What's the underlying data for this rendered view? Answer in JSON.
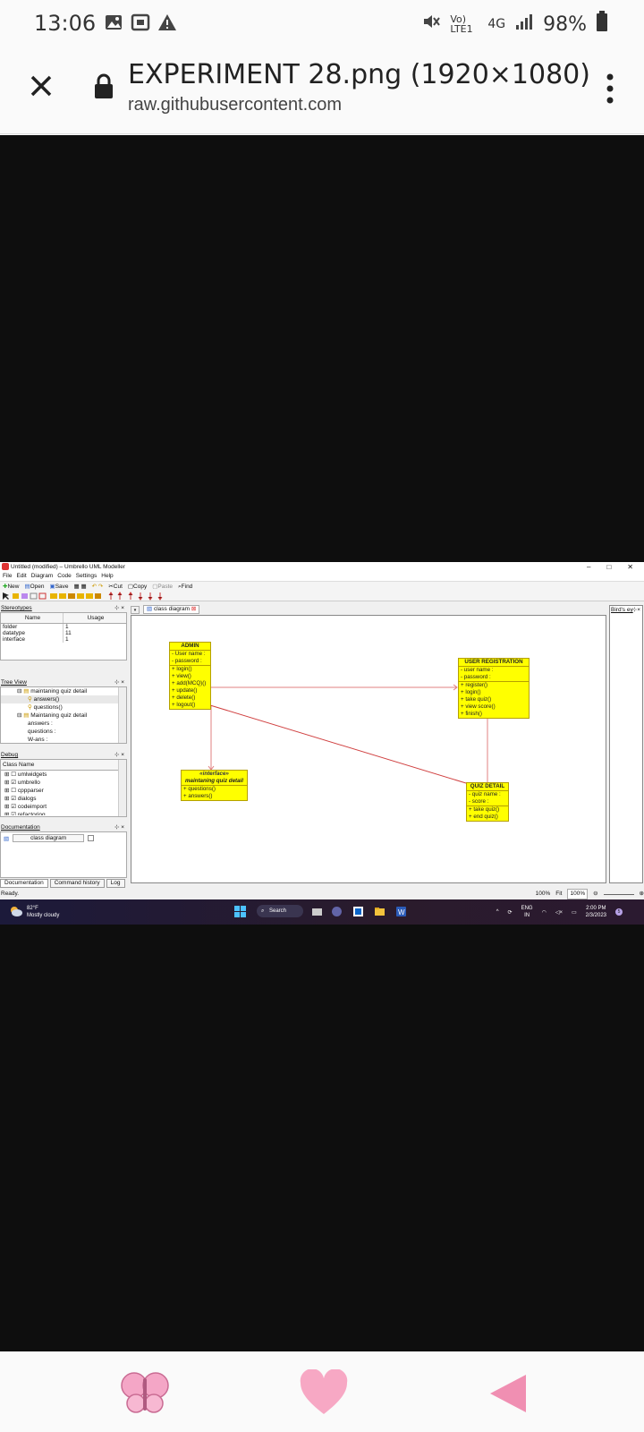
{
  "status_bar": {
    "time": "13:06",
    "lte_label": "Vo) LTE1",
    "net": "4G",
    "battery": "98%",
    "icons": [
      "image-icon",
      "screenshot-icon",
      "warning-icon",
      "mute-icon",
      "signal-icon",
      "battery-icon"
    ]
  },
  "browser": {
    "title": "EXPERIMENT 28.png (1920×1080)",
    "domain": "raw.githubusercontent.com"
  },
  "app": {
    "window_title": "Untitled (modified) – Umbrello UML Modeller",
    "window_buttons": [
      "–",
      "□",
      "✕"
    ],
    "menu": [
      "File",
      "Edit",
      "Diagram",
      "Code",
      "Settings",
      "Help"
    ],
    "toolbar": [
      "New",
      "Open",
      "Save",
      "Cut",
      "Copy",
      "Paste",
      "Find"
    ],
    "stereotypes": {
      "title": "Stereotypes",
      "headers": [
        "Name",
        "Usage"
      ],
      "rows": [
        {
          "name": "folder",
          "usage": "1"
        },
        {
          "name": "datatype",
          "usage": "11"
        },
        {
          "name": "interface",
          "usage": "1"
        }
      ]
    },
    "tree_view": {
      "title": "Tree View",
      "items": [
        "maintaning quiz detail",
        "answers()",
        "questions()",
        "Maintaning quiz detail",
        "answers :",
        "questions :",
        "W-ans :"
      ]
    },
    "debug": {
      "title": "Debug",
      "header": "Class Name",
      "items": [
        "umlwidgets",
        "umbrello",
        "cppparser",
        "dialogs",
        "codeimport",
        "refactoring"
      ]
    },
    "documentation": {
      "title": "Documentation",
      "field": "class diagram"
    },
    "bottom_tabs": [
      "Documentation",
      "Command history",
      "Log"
    ],
    "diagram_tab": "class diagram",
    "birds_eye": "Bird's ey",
    "classes": {
      "admin": {
        "name": "ADMIN",
        "attributes": [
          "- User name :",
          "- password :"
        ],
        "operations": [
          "+ login()",
          "+ view()",
          "+ add(MCQ)()",
          "+ update()",
          "+ delete()",
          "+ logout()"
        ]
      },
      "user_registration": {
        "name": "USER REGISTRATION",
        "attributes": [
          "- user name :",
          "- password :"
        ],
        "operations": [
          "+ register()",
          "+ login()",
          "+ take quiz()",
          "+ view score()",
          "+ finish()"
        ]
      },
      "interface": {
        "stereotype": "«interface»",
        "name": "maintaning quiz detail",
        "operations": [
          "+ questions()",
          "+ answers()"
        ]
      },
      "quiz_detail": {
        "name": "QUIZ DETAIL",
        "attributes": [
          "- quiz name :",
          "- score :"
        ],
        "operations": [
          "+ take quiz()",
          "+ end quiz()"
        ]
      }
    },
    "status": "Ready.",
    "zoom": {
      "value": "100%",
      "fit": "Fit",
      "field": "100%"
    },
    "taskbar": {
      "temp": "82°F",
      "weather": "Mostly cloudy",
      "search": "Search",
      "lang": "ENG",
      "region": "IN",
      "clock_time": "2:00 PM",
      "clock_date": "2/3/2023"
    }
  },
  "colors": {
    "class_fill": "#ffff00",
    "association_line": "#e06060",
    "viewer_bg": "#0e0e0e"
  }
}
